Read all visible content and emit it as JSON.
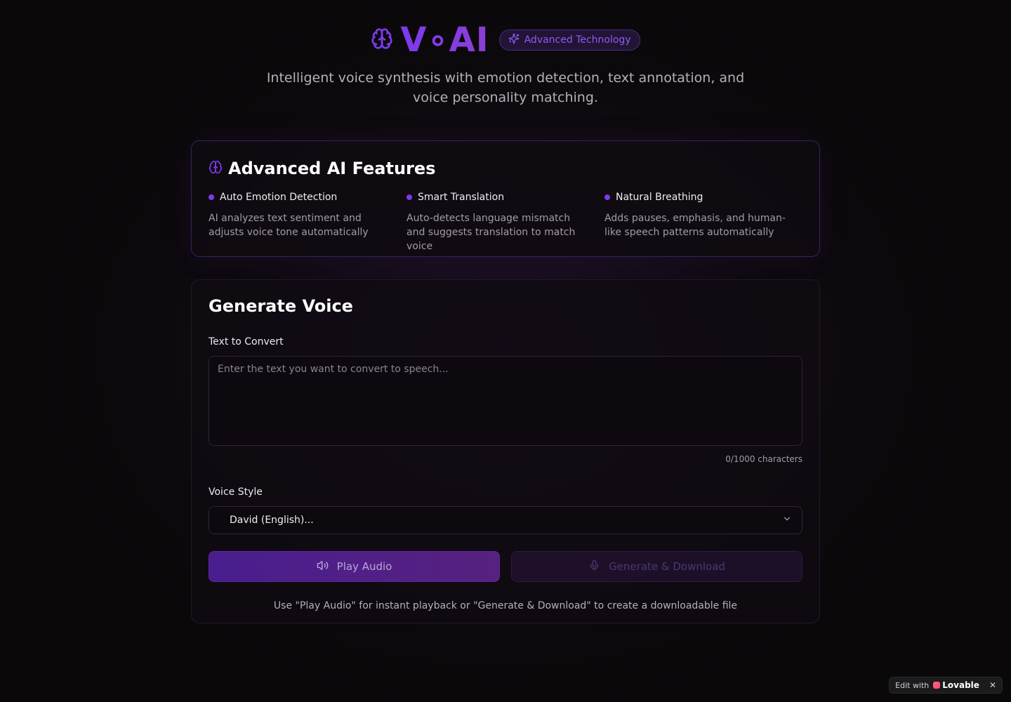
{
  "header": {
    "brand_title": "V∘AI",
    "badge_label": "Advanced Technology",
    "subtitle": "Intelligent voice synthesis with emotion detection, text annotation, and voice personality matching."
  },
  "features": {
    "heading": "Advanced AI Features",
    "items": [
      {
        "title": "Auto Emotion Detection",
        "description": "AI analyzes text sentiment and adjusts voice tone automatically"
      },
      {
        "title": "Smart Translation",
        "description": "Auto-detects language mismatch and suggests translation to match voice"
      },
      {
        "title": "Natural Breathing",
        "description": "Adds pauses, emphasis, and human-like speech patterns automatically"
      }
    ]
  },
  "generate": {
    "heading": "Generate Voice",
    "text_label": "Text to Convert",
    "text_placeholder": "Enter the text you want to convert to speech...",
    "text_value": "",
    "char_count": "0/1000 characters",
    "voice_label": "Voice Style",
    "voice_selected": "David (English)...",
    "play_button": "Play Audio",
    "generate_button": "Generate & Download",
    "hint": "Use \"Play Audio\" for instant playback or \"Generate & Download\" to create a downloadable file"
  },
  "edit_badge": {
    "prefix": "Edit with",
    "brand": "Lovable",
    "close": "✕"
  },
  "colors": {
    "accent": "#7c3aed",
    "background": "#0a0809"
  }
}
